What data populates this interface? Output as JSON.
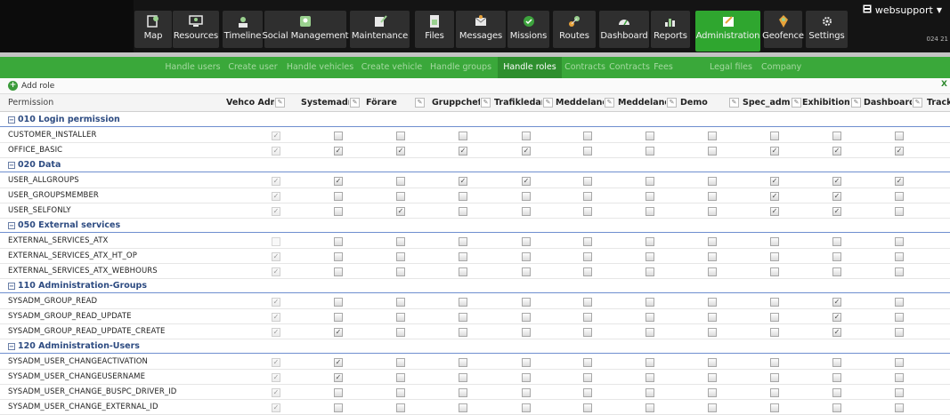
{
  "nav": {
    "items": [
      {
        "key": "map",
        "label": "Map",
        "icon": "map-icon"
      },
      {
        "key": "resources",
        "label": "Resources",
        "icon": "resources-icon"
      },
      {
        "key": "timeline",
        "label": "Timeline",
        "icon": "timeline-icon"
      },
      {
        "key": "social",
        "label": "Social Management",
        "icon": "social-icon"
      },
      {
        "key": "maintenance",
        "label": "Maintenance",
        "icon": "maintenance-icon"
      },
      {
        "key": "files",
        "label": "Files",
        "icon": "files-icon"
      },
      {
        "key": "messages",
        "label": "Messages",
        "icon": "messages-icon"
      },
      {
        "key": "missions",
        "label": "Missions",
        "icon": "missions-icon"
      },
      {
        "key": "routes",
        "label": "Routes",
        "icon": "routes-icon"
      },
      {
        "key": "dashboard",
        "label": "Dashboard",
        "icon": "dashboard-icon"
      },
      {
        "key": "reports",
        "label": "Reports",
        "icon": "reports-icon"
      },
      {
        "key": "administration",
        "label": "Administration",
        "icon": "administration-icon",
        "active": true
      },
      {
        "key": "geofence",
        "label": "Geofence",
        "icon": "geofence-icon"
      },
      {
        "key": "settings",
        "label": "Settings",
        "icon": "settings-icon"
      }
    ],
    "user": "websupport",
    "user_sub": "024 21"
  },
  "subnav": {
    "items": [
      {
        "label": "Handle users"
      },
      {
        "label": "Create user"
      },
      {
        "label": "Handle vehicles"
      },
      {
        "label": "Create vehicle"
      },
      {
        "label": "Handle groups"
      },
      {
        "label": "Handle roles",
        "active": true
      },
      {
        "label": "Contracts"
      },
      {
        "label": "Contracts"
      },
      {
        "label": "Fees"
      },
      {
        "label": "Legal files"
      },
      {
        "label": "Company"
      }
    ]
  },
  "toolbar": {
    "add_role": "Add role"
  },
  "table": {
    "permission_header": "Permission",
    "columns": [
      "Vehco Admi",
      "Systemadm",
      "Förare",
      "Gruppchef",
      "Trafikledare",
      "Meddelande",
      "Meddelande",
      "Demo",
      "Spec_admir",
      "Exhibition",
      "Dashboard",
      "Track"
    ],
    "groups": [
      {
        "name": "010 Login permission",
        "rows": [
          {
            "name": "CUSTOMER_INSTALLER",
            "checks": [
              "dc",
              0,
              0,
              0,
              0,
              0,
              0,
              0,
              0,
              0,
              0
            ]
          },
          {
            "name": "OFFICE_BASIC",
            "checks": [
              "dc",
              1,
              1,
              1,
              1,
              0,
              0,
              0,
              1,
              1,
              1
            ]
          }
        ]
      },
      {
        "name": "020 Data",
        "rows": [
          {
            "name": "USER_ALLGROUPS",
            "checks": [
              "dc",
              1,
              0,
              1,
              1,
              0,
              0,
              0,
              1,
              1,
              1
            ]
          },
          {
            "name": "USER_GROUPSMEMBER",
            "checks": [
              "dc",
              0,
              0,
              0,
              0,
              0,
              0,
              0,
              1,
              1,
              0
            ]
          },
          {
            "name": "USER_SELFONLY",
            "checks": [
              "dc",
              0,
              1,
              0,
              0,
              0,
              0,
              0,
              1,
              1,
              0
            ]
          }
        ]
      },
      {
        "name": "050 External services",
        "rows": [
          {
            "name": "EXTERNAL_SERVICES_ATX",
            "checks": [
              "b",
              0,
              0,
              0,
              0,
              0,
              0,
              0,
              0,
              0,
              0
            ]
          },
          {
            "name": "EXTERNAL_SERVICES_ATX_HT_OP",
            "checks": [
              "dc",
              0,
              0,
              0,
              0,
              0,
              0,
              0,
              0,
              0,
              0
            ]
          },
          {
            "name": "EXTERNAL_SERVICES_ATX_WEBHOURS",
            "checks": [
              "dc",
              0,
              0,
              0,
              0,
              0,
              0,
              0,
              0,
              0,
              0
            ]
          }
        ]
      },
      {
        "name": "110 Administration-Groups",
        "rows": [
          {
            "name": "SYSADM_GROUP_READ",
            "checks": [
              "dc",
              0,
              0,
              0,
              0,
              0,
              0,
              0,
              0,
              1,
              0
            ]
          },
          {
            "name": "SYSADM_GROUP_READ_UPDATE",
            "checks": [
              "dc",
              0,
              0,
              0,
              0,
              0,
              0,
              0,
              0,
              1,
              0
            ]
          },
          {
            "name": "SYSADM_GROUP_READ_UPDATE_CREATE",
            "checks": [
              "dc",
              1,
              0,
              0,
              0,
              0,
              0,
              0,
              0,
              1,
              0
            ]
          }
        ]
      },
      {
        "name": "120 Administration-Users",
        "rows": [
          {
            "name": "SYSADM_USER_CHANGEACTIVATION",
            "checks": [
              "dc",
              1,
              0,
              0,
              0,
              0,
              0,
              0,
              0,
              0,
              0
            ]
          },
          {
            "name": "SYSADM_USER_CHANGEUSERNAME",
            "checks": [
              "dc",
              1,
              0,
              0,
              0,
              0,
              0,
              0,
              0,
              0,
              0
            ]
          },
          {
            "name": "SYSADM_USER_CHANGE_BUSPC_DRIVER_ID",
            "checks": [
              "dc",
              0,
              0,
              0,
              0,
              0,
              0,
              0,
              0,
              0,
              0
            ]
          },
          {
            "name": "SYSADM_USER_CHANGE_EXTERNAL_ID",
            "checks": [
              "dc",
              0,
              0,
              0,
              0,
              0,
              0,
              0,
              0,
              0,
              0
            ]
          }
        ]
      }
    ]
  },
  "colors": {
    "accent": "#3aa83a",
    "active_tab": "#2e8f2e",
    "group_text": "#2e4c82"
  }
}
